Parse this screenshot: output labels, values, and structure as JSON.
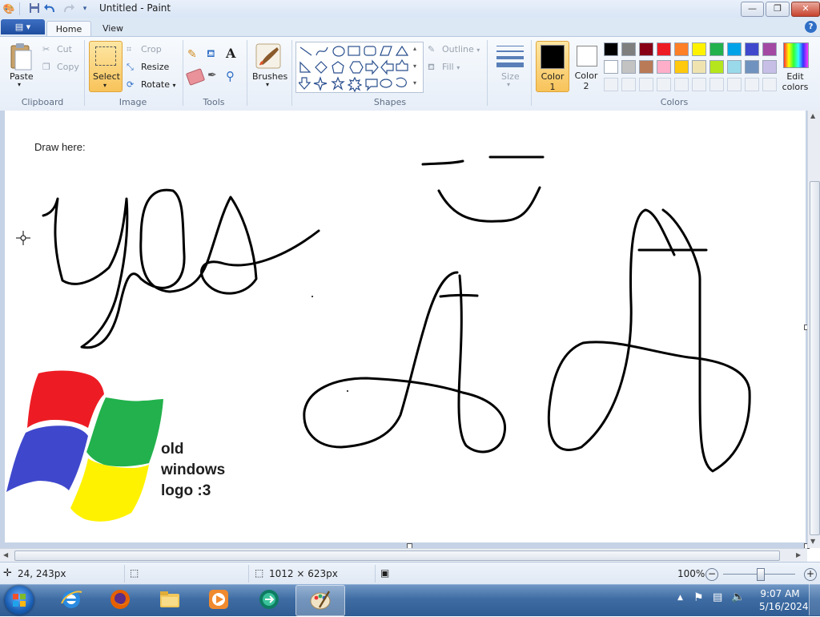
{
  "window": {
    "title": "Untitled - Paint",
    "controls": {
      "minimize": "—",
      "maximize": "❐",
      "close": "✕"
    }
  },
  "tabs": {
    "file": "▤ ▾",
    "home": "Home",
    "view": "View"
  },
  "ribbon": {
    "clipboard": {
      "label": "Clipboard",
      "paste": "Paste",
      "cut": "Cut",
      "copy": "Copy"
    },
    "image": {
      "label": "Image",
      "select": "Select",
      "crop": "Crop",
      "resize": "Resize",
      "rotate": "Rotate"
    },
    "tools": {
      "label": "Tools"
    },
    "brushes": {
      "label": "Brushes"
    },
    "shapes": {
      "label": "Shapes",
      "outline": "Outline",
      "fill": "Fill"
    },
    "size": {
      "label": "Size"
    },
    "colors": {
      "label": "Colors",
      "color1": "Color 1",
      "color2": "Color 2",
      "edit": "Edit colors",
      "color1_value": "#000000",
      "color2_value": "#ffffff",
      "palette_row1": [
        "#000000",
        "#7f7f7f",
        "#880015",
        "#ed1c24",
        "#ff7f27",
        "#fff200",
        "#22b14c",
        "#00a2e8",
        "#3f48cc",
        "#a349a4"
      ],
      "palette_row2": [
        "#ffffff",
        "#c3c3c3",
        "#b97a57",
        "#ffaec9",
        "#ffc90e",
        "#efe4b0",
        "#b5e61d",
        "#99d9ea",
        "#7092be",
        "#c8bfe7"
      ]
    }
  },
  "canvas": {
    "hint": "Draw here:",
    "logo_text": [
      "old",
      "windows",
      "logo :3"
    ],
    "logo_colors": {
      "red": "#ed1c24",
      "green": "#22b14c",
      "blue": "#3f48cc",
      "yellow": "#fff200"
    }
  },
  "status": {
    "cursor": "24, 243px",
    "size": "1012 × 623px",
    "zoom": "100%"
  },
  "taskbar": {
    "time": "9:07 AM",
    "date": "5/16/2024"
  }
}
